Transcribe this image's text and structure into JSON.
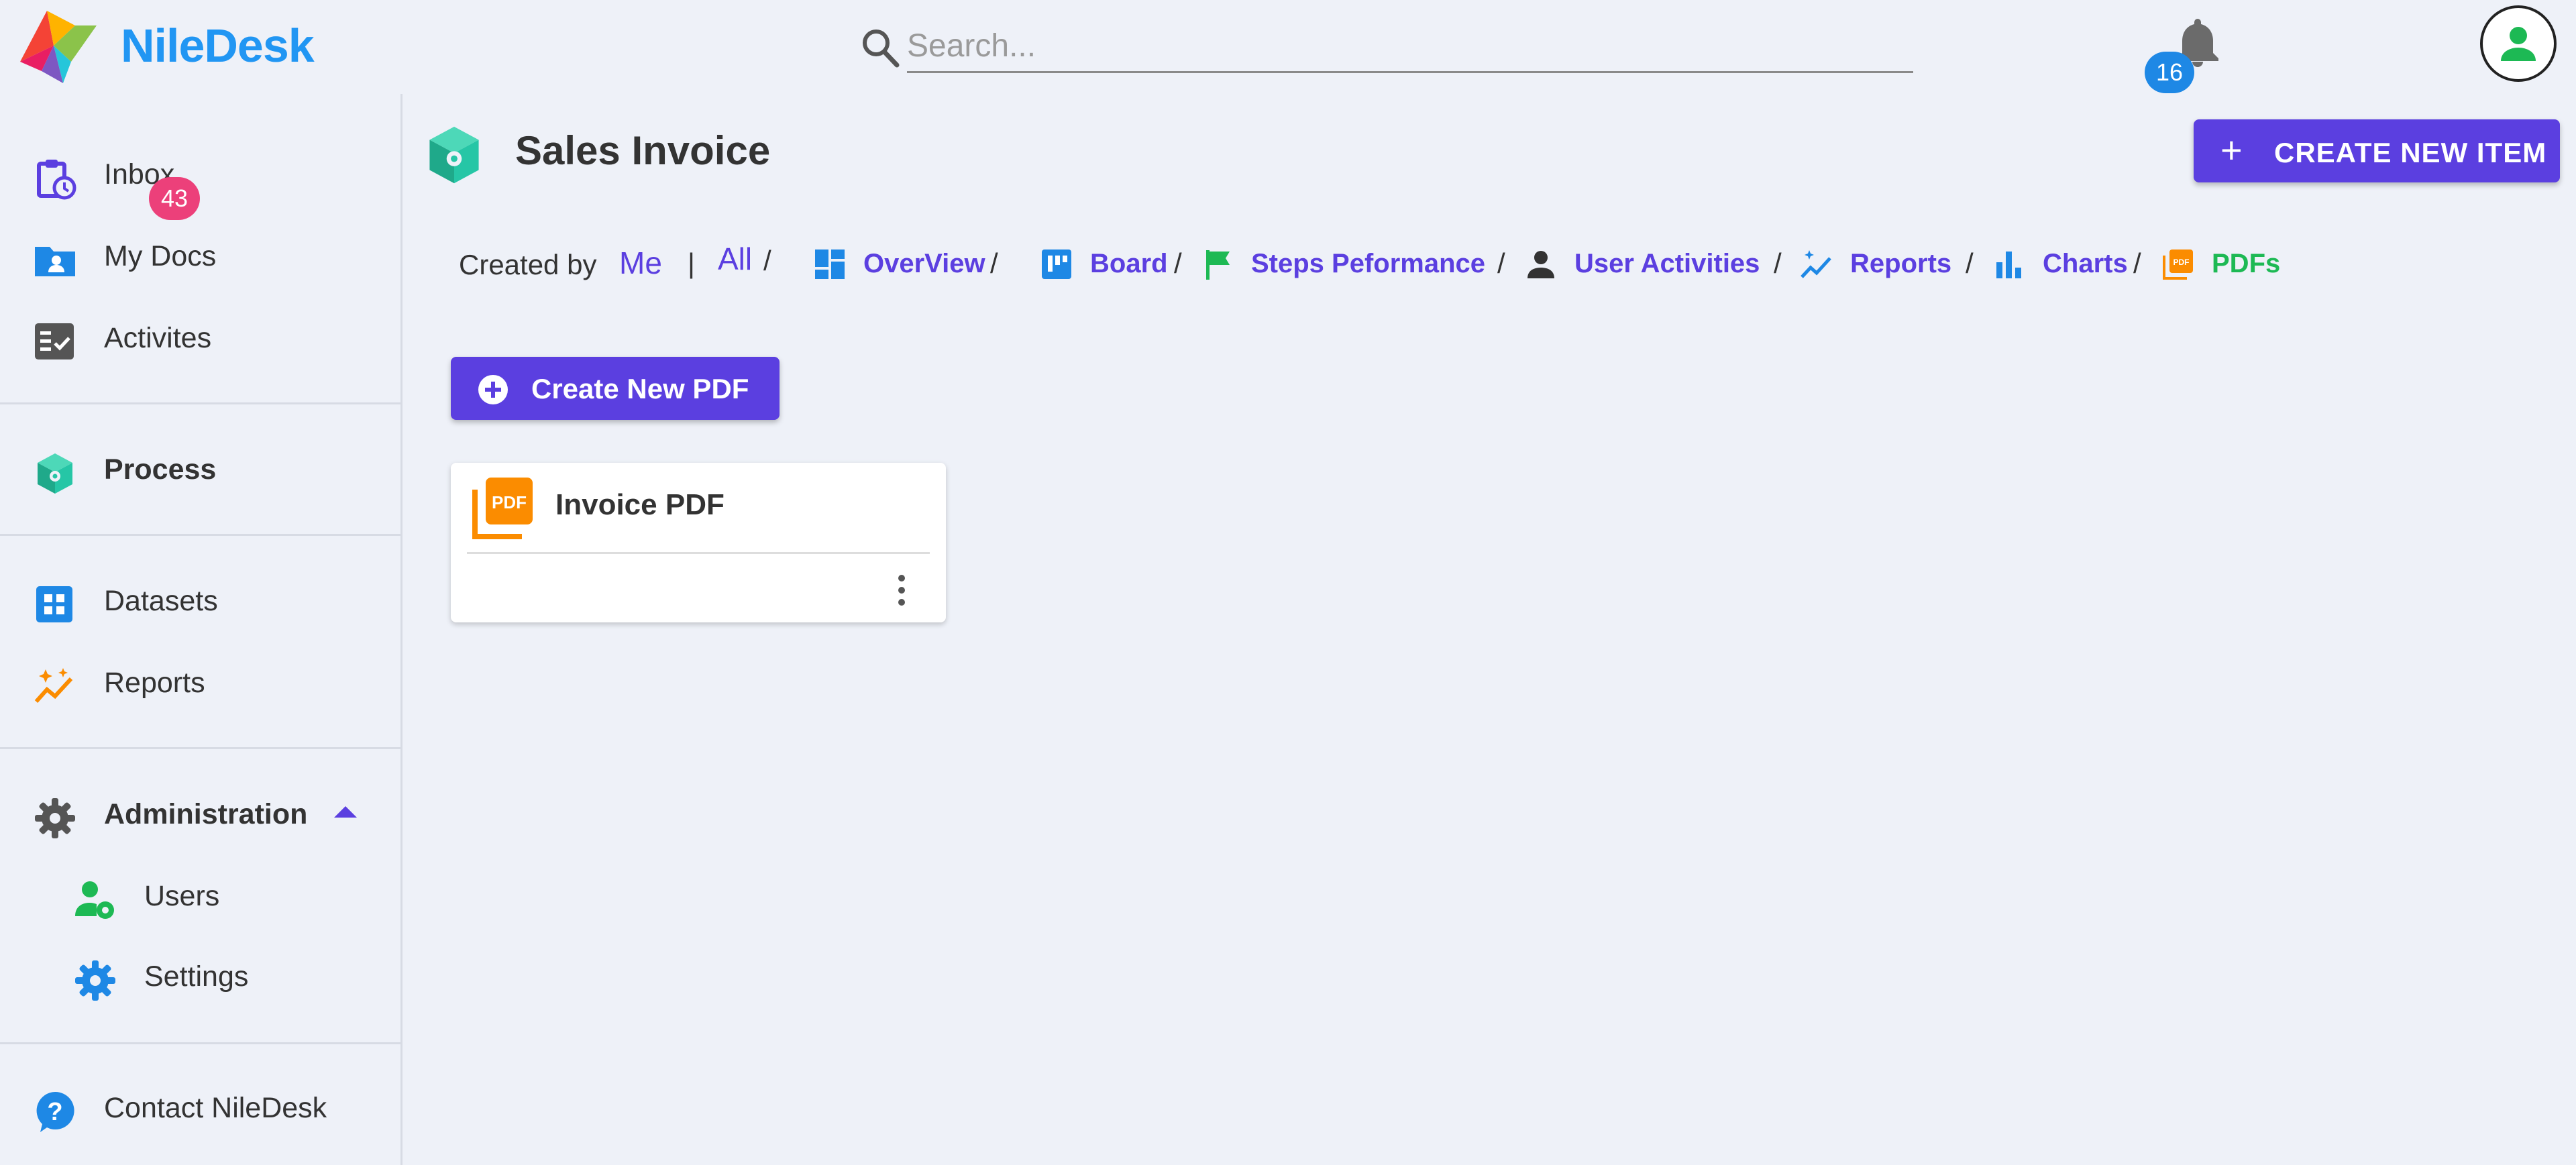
{
  "app": {
    "brand": "NileDesk"
  },
  "search": {
    "placeholder": "Search..."
  },
  "notifications": {
    "count": "16"
  },
  "sidebar": {
    "inbox": {
      "label": "Inbox",
      "badge": "43"
    },
    "my_docs": "My Docs",
    "activities": "Activites",
    "process": "Process",
    "datasets": "Datasets",
    "reports": "Reports",
    "administration": "Administration",
    "users": "Users",
    "settings": "Settings",
    "contact": "Contact NileDesk"
  },
  "page": {
    "title": "Sales Invoice",
    "create_item_label": "CREATE NEW ITEM"
  },
  "filters": {
    "created_by_label": "Created by",
    "me": "Me",
    "all": "All",
    "views": {
      "overview": "OverView",
      "board": "Board",
      "steps": "Steps Peformance",
      "user_activities": "User Activities",
      "reports": "Reports",
      "charts": "Charts",
      "pdfs": "PDFs"
    }
  },
  "pdf_section": {
    "create_label": "Create New PDF",
    "items": [
      {
        "title": "Invoice PDF"
      }
    ]
  },
  "colors": {
    "accent": "#5b3fe0",
    "brand": "#2196f3",
    "active_view": "#1db954",
    "inbox_badge": "#ec407a",
    "bell_badge": "#1e88e5",
    "process_icon": "#26c6a6",
    "background": "#eef1f8"
  },
  "icons": {
    "logo": "niledesk-logo",
    "search": "search-icon",
    "bell": "bell-icon",
    "avatar": "user-avatar-icon",
    "inbox": "clipboard-clock-icon",
    "my_docs": "folder-user-icon",
    "activities": "checklist-icon",
    "process": "cube-icon",
    "datasets": "grid-icon",
    "reports": "sparkline-icon",
    "administration": "gear-icon",
    "users": "user-gear-icon",
    "settings": "gear-icon",
    "contact": "help-icon",
    "pdf": "pdf-icon",
    "more": "more-vert-icon"
  }
}
